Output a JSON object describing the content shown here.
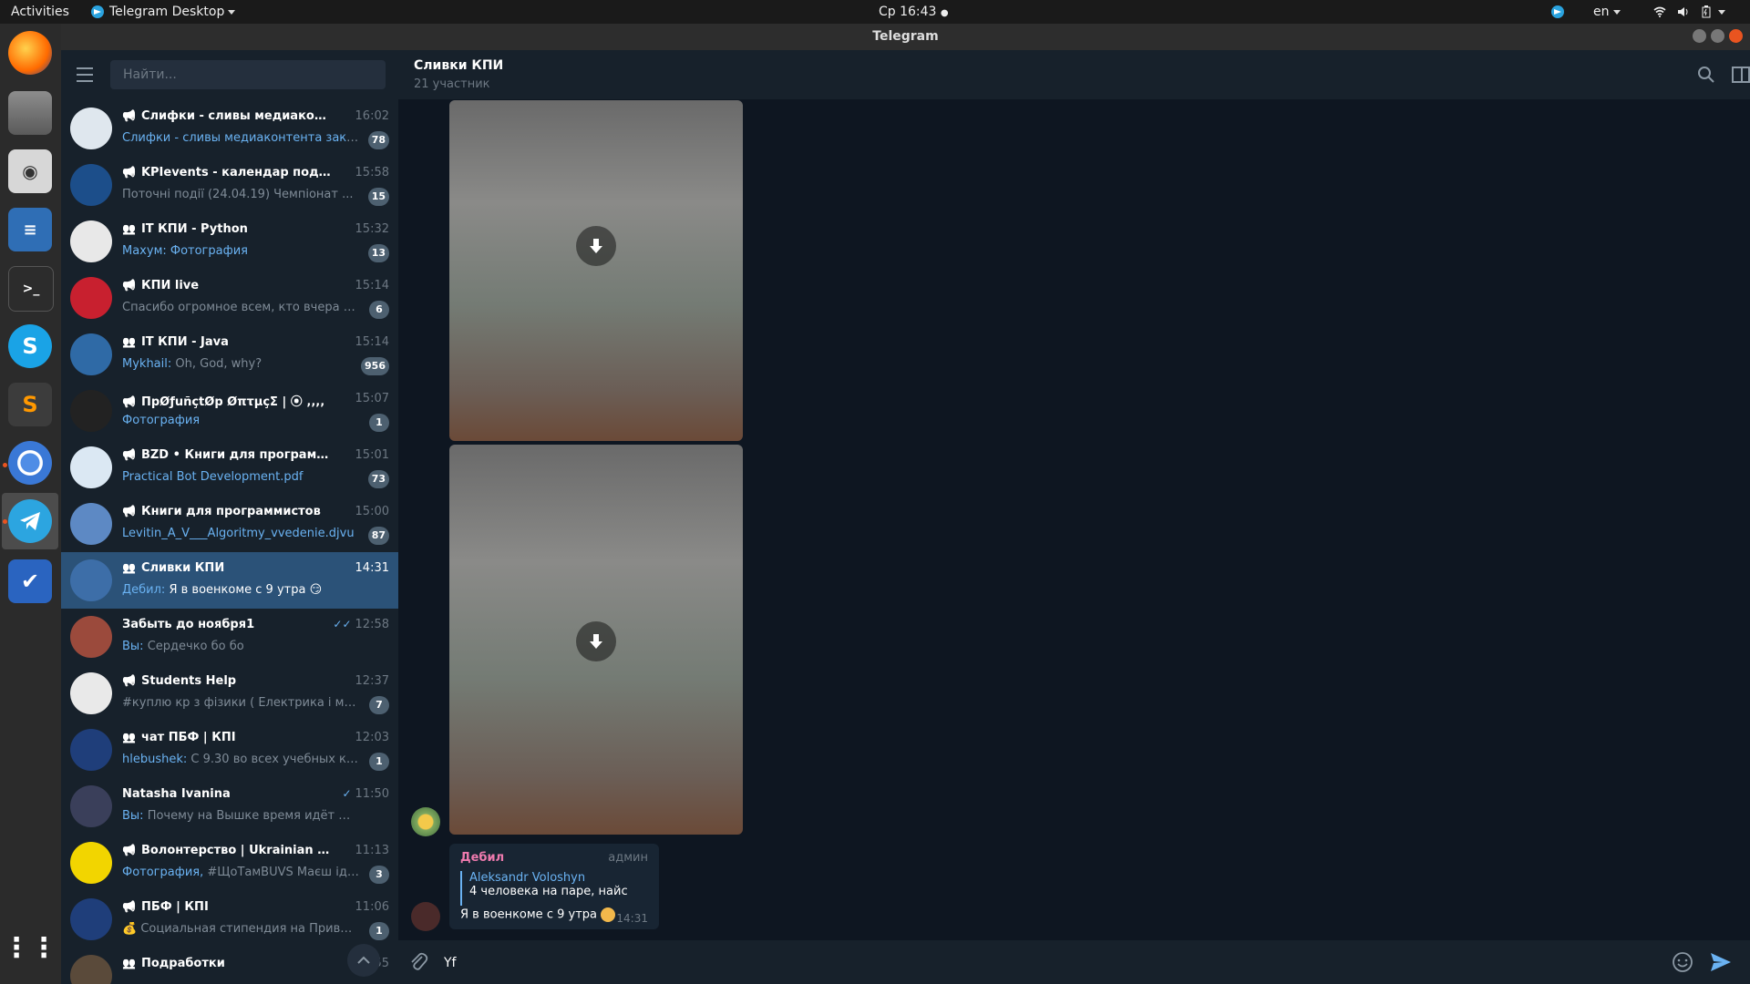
{
  "topbar": {
    "activities": "Activities",
    "app_menu": "Telegram Desktop",
    "clock": "Ср 16:43",
    "lang": "en"
  },
  "window": {
    "title": "Telegram"
  },
  "search": {
    "placeholder": "Найти..."
  },
  "chats": [
    {
      "name": "Слифки - сливы медиаконтента",
      "time": "16:02",
      "prefix": "",
      "preview": "Слифки - сливы медиаконтента закреп...",
      "badge": "78",
      "type": "channel",
      "avatar_color": "#dfe7ee",
      "highlight": true
    },
    {
      "name": "KPIevents - календар подій КПІ",
      "time": "15:58",
      "prefix": "",
      "preview": "Поточні події (24.04.19)   Чемпіонат ...",
      "badge": "15",
      "type": "channel",
      "avatar_color": "#1c4e8a",
      "highlight": false
    },
    {
      "name": "IT КПИ - Python",
      "time": "15:32",
      "prefix": "Махум: ",
      "preview": "Фотография",
      "badge": "13",
      "type": "group",
      "avatar_color": "#e8e8e8",
      "highlight": true
    },
    {
      "name": "КПИ live",
      "time": "15:14",
      "prefix": "",
      "preview": "Спасибо огромное всем, кто вчера подд...",
      "badge": "6",
      "type": "channel",
      "avatar_color": "#c8202f",
      "highlight": false
    },
    {
      "name": "IT КПИ - Java",
      "time": "15:14",
      "prefix": "Mykhail: ",
      "preview": "Oh, God, why?",
      "badge": "956",
      "type": "group",
      "avatar_color": "#2f6aa6",
      "highlight": false
    },
    {
      "name": "ПрØƒuñçtØр ØπτµçΣ | ⦿ ‚‚‚‚",
      "time": "15:07",
      "prefix": "",
      "preview": "Фотография",
      "badge": "1",
      "type": "channel",
      "avatar_color": "#222222",
      "highlight": true
    },
    {
      "name": "BZD • Книги для программистов",
      "time": "15:01",
      "prefix": "",
      "preview": "Practical Bot Development.pdf",
      "badge": "73",
      "type": "channel",
      "avatar_color": "#dbe8f3",
      "highlight": true
    },
    {
      "name": "Книги для программистов",
      "time": "15:00",
      "prefix": "",
      "preview": "Levitin_A_V___Algoritmy_vvedenie.djvu",
      "badge": "87",
      "type": "channel",
      "avatar_color": "#5d89c4",
      "highlight": true
    },
    {
      "name": "Сливки КПИ",
      "time": "14:31",
      "prefix": "Дебил: ",
      "preview": "Я в военкоме с 9 утра 😏",
      "badge": "",
      "type": "group",
      "avatar_color": "#3d6ea8",
      "highlight": false,
      "active": true
    },
    {
      "name": "Забыть до ноября1",
      "time": "12:58",
      "prefix": "Вы: ",
      "preview": "Сердечко бо бо",
      "badge": "",
      "type": "",
      "avatar_color": "#9b4a3c",
      "highlight": false,
      "read": "double"
    },
    {
      "name": "Students Help",
      "time": "12:37",
      "prefix": "",
      "preview": "#куплю кр з фізики ( Електрика і магнет...",
      "badge": "7",
      "type": "channel",
      "avatar_color": "#e9e9e9",
      "highlight": false
    },
    {
      "name": "чат ПБФ | КПІ",
      "time": "12:03",
      "prefix": "hlebushek: ",
      "preview": "С 9.30 во всех учебных корпу...",
      "badge": "1",
      "type": "group",
      "avatar_color": "#1f3e7a",
      "highlight": false
    },
    {
      "name": "Natasha Ivanina",
      "time": "11:50",
      "prefix": "Вы: ",
      "preview": "Почему на Вышке время идёт медленне...",
      "badge": "",
      "type": "",
      "avatar_color": "#3a3f5a",
      "highlight": false,
      "read": "single"
    },
    {
      "name": "Волонтерство | Ukrainian Voluntee...",
      "time": "11:13",
      "prefix": "Фотография, ",
      "preview": "#ЩоТамBUVS  Маєш ідею в...",
      "badge": "3",
      "type": "channel",
      "avatar_color": "#f2d500",
      "highlight": false
    },
    {
      "name": "ПБФ | КПІ",
      "time": "11:06",
      "prefix": "",
      "preview": "💰 Социальная стипендия на Привате",
      "badge": "1",
      "type": "channel",
      "avatar_color": "#1f3e7a",
      "highlight": false
    },
    {
      "name": "Подработки",
      "time": "10:55",
      "prefix": "",
      "preview": "",
      "badge": "",
      "type": "group",
      "avatar_color": "#5a4a3a",
      "highlight": false
    }
  ],
  "chat": {
    "title": "Сливки КПИ",
    "subtitle": "21 участник"
  },
  "message": {
    "sender": "Дебил",
    "role": "админ",
    "reply_name": "Aleksandr Voloshyn",
    "reply_text": "4 человека на паре, найс",
    "text": "Я в военкоме с 9 утра",
    "time": "14:31"
  },
  "composer": {
    "value": "Yf"
  },
  "colors": {
    "accent": "#6ab2f2",
    "active_row": "#2b5278",
    "sidebar_bg": "#17212b",
    "chat_bg": "#0e1621"
  }
}
